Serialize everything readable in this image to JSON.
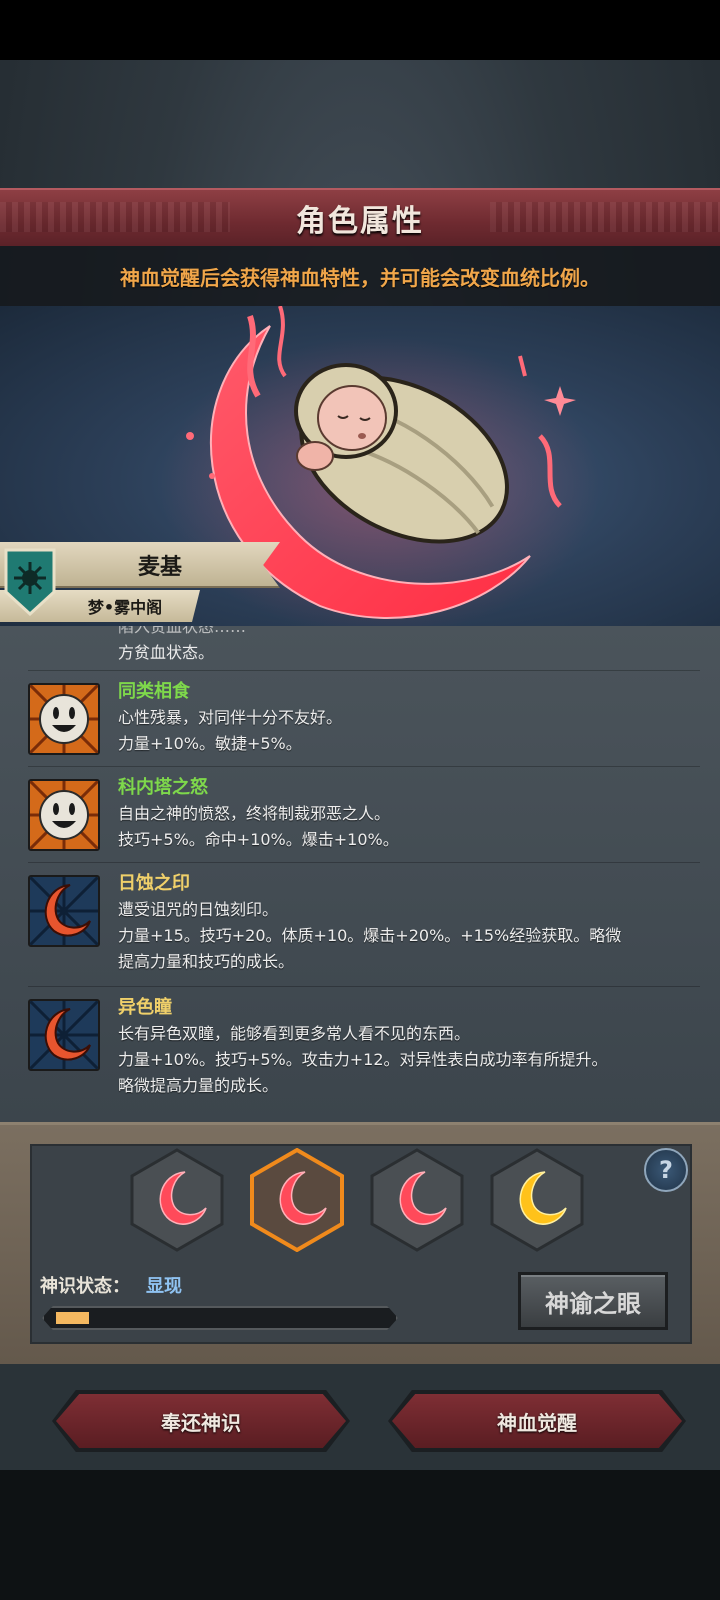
{
  "header": {
    "title": "角色属性"
  },
  "notice": "神血觉醒后会获得神血特性，并可能会改变血统比例。",
  "character": {
    "name": "麦基",
    "faction": "梦•雾中阁"
  },
  "traits_partial": {
    "line_top": "陷入贫血状态……",
    "line_bottom": "方贫血状态。"
  },
  "traits": [
    {
      "name": "同类相食",
      "color": "#7ed84b",
      "icon": "smiley-face-icon",
      "lines": [
        "心性残暴，对同伴十分不友好。",
        "力量+10%。敏捷+5%。"
      ]
    },
    {
      "name": "科内塔之怒",
      "color": "#7ed84b",
      "icon": "smiley-face-icon",
      "lines": [
        "自由之神的愤怒，终将制裁邪恶之人。",
        "技巧+5%。命中+10%。爆击+10%。"
      ]
    },
    {
      "name": "日蚀之印",
      "color": "#f0d06a",
      "icon": "red-crescent-icon",
      "lines": [
        "遭受诅咒的日蚀刻印。",
        "力量+15。技巧+20。体质+10。爆击+20%。+15%经验获取。略微",
        "提高力量和技巧的成长。"
      ]
    },
    {
      "name": "异色瞳",
      "color": "#f0d06a",
      "icon": "red-crescent-icon",
      "lines": [
        "长有异色双瞳，能够看到更多常人看不见的东西。",
        "力量+10%。技巧+5%。攻击力+12。对异性表白成功率有所提升。",
        "略微提高力量的成长。"
      ]
    }
  ],
  "runes": [
    "red-crescent-rune",
    "red-crescent-rune-selected",
    "red-crescent-rune",
    "gold-crescent-rune"
  ],
  "help_icon": "?",
  "divine_status": {
    "label": "神识状态：",
    "value": "显现",
    "progress": 0.1
  },
  "oracle_button": "神谕之眼",
  "buttons": {
    "return": "奉还神识",
    "awaken": "神血觉醒"
  }
}
